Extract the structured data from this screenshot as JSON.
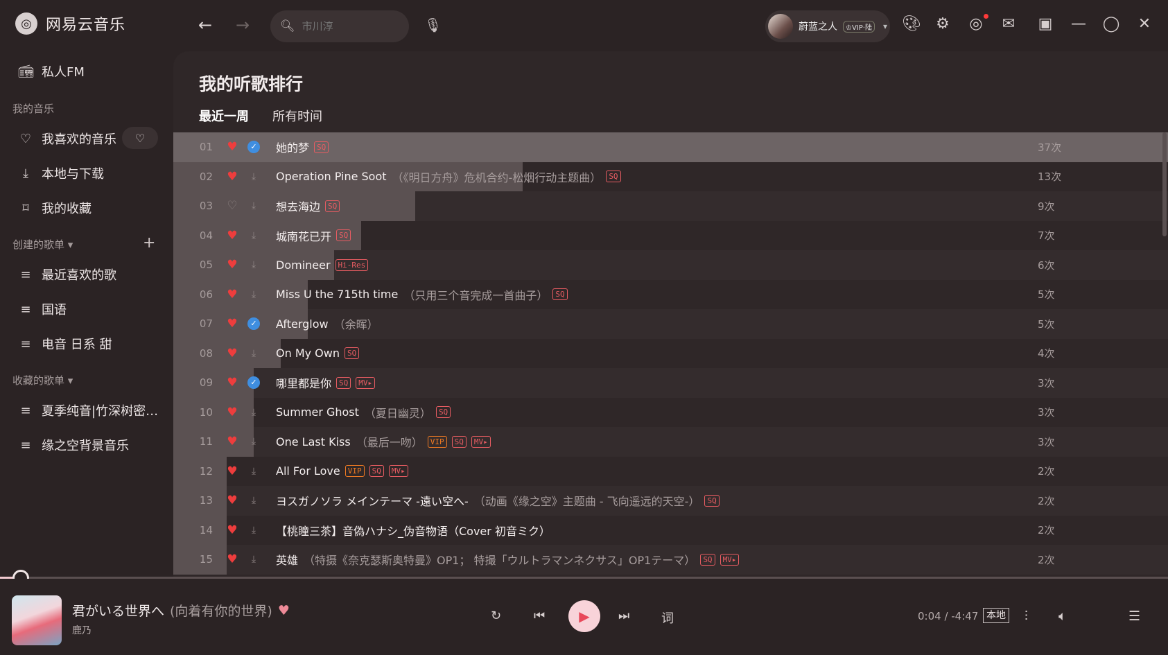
{
  "app": {
    "name": "网易云音乐",
    "logo_glyph": "◎"
  },
  "nav": {
    "back": "←",
    "forward": "→"
  },
  "search": {
    "placeholder": "市川淳",
    "icon": "🔍︎",
    "mic_icon": "🎙︎"
  },
  "user": {
    "name": "蔚蓝之人",
    "vip": "♔VIP·陆",
    "caret": "▾"
  },
  "top_icons": {
    "skin": "🎨︎",
    "settings": "⚙",
    "cloud": "◎",
    "mail": "✉",
    "miniplayer": "▣",
    "minimize": "—",
    "maximize": "◯",
    "close": "✕"
  },
  "sidebar": {
    "fm": {
      "label": "私人FM",
      "icon": "📻︎"
    },
    "section_my_music": "我的音乐",
    "liked": {
      "label": "我喜欢的音乐",
      "icon": "♡",
      "pill_icon": "♡"
    },
    "local": {
      "label": "本地与下载",
      "icon": "⤓"
    },
    "collect": {
      "label": "我的收藏",
      "icon": "⌑"
    },
    "section_created": "创建的歌单 ▾",
    "add_icon": "+",
    "created": [
      {
        "label": "最近喜欢的歌",
        "icon": "≡"
      },
      {
        "label": "国语",
        "icon": "≡"
      },
      {
        "label": "电音 日系 甜",
        "icon": "≡"
      }
    ],
    "section_collected": "收藏的歌单 ▾",
    "collected": [
      {
        "label": "夏季纯音|竹深树密…",
        "icon": "≡"
      },
      {
        "label": "缘之空背景音乐",
        "icon": "≡"
      }
    ]
  },
  "page": {
    "title": "我的听歌排行",
    "tabs": [
      "最近一周",
      "所有时间"
    ]
  },
  "songs": [
    {
      "no": "01",
      "liked": true,
      "downloaded": true,
      "title": "她的梦",
      "sub": "",
      "tags": [
        "SQ"
      ],
      "count": "37次",
      "ratio": 1.0
    },
    {
      "no": "02",
      "liked": true,
      "downloaded": false,
      "title": "Operation Pine Soot",
      "sub": "（《明日方舟》危机合约-松烟行动主题曲）",
      "tags": [
        "SQ"
      ],
      "count": "13次",
      "ratio": 0.351
    },
    {
      "no": "03",
      "liked": false,
      "downloaded": false,
      "title": "想去海边",
      "sub": "",
      "tags": [
        "SQ"
      ],
      "count": "9次",
      "ratio": 0.243
    },
    {
      "no": "04",
      "liked": true,
      "downloaded": false,
      "title": "城南花已开",
      "sub": "",
      "tags": [
        "SQ"
      ],
      "count": "7次",
      "ratio": 0.189
    },
    {
      "no": "05",
      "liked": true,
      "downloaded": false,
      "title": "Domineer",
      "sub": "",
      "tags": [
        "Hi-Res"
      ],
      "count": "6次",
      "ratio": 0.162
    },
    {
      "no": "06",
      "liked": true,
      "downloaded": false,
      "title": "Miss U the 715th time",
      "sub": "（只用三个音完成一首曲子）",
      "tags": [
        "SQ"
      ],
      "count": "5次",
      "ratio": 0.135
    },
    {
      "no": "07",
      "liked": true,
      "downloaded": true,
      "title": "Afterglow",
      "sub": "（余晖）",
      "tags": [],
      "count": "5次",
      "ratio": 0.135
    },
    {
      "no": "08",
      "liked": true,
      "downloaded": false,
      "title": "On My Own",
      "sub": "",
      "tags": [
        "SQ"
      ],
      "count": "4次",
      "ratio": 0.108
    },
    {
      "no": "09",
      "liked": true,
      "downloaded": true,
      "title": "哪里都是你",
      "sub": "",
      "tags": [
        "SQ",
        "MV▸"
      ],
      "count": "3次",
      "ratio": 0.081
    },
    {
      "no": "10",
      "liked": true,
      "downloaded": false,
      "title": "Summer Ghost",
      "sub": "（夏日幽灵）",
      "tags": [
        "SQ"
      ],
      "count": "3次",
      "ratio": 0.081
    },
    {
      "no": "11",
      "liked": true,
      "downloaded": false,
      "title": "One Last Kiss",
      "sub": "（最后一吻）",
      "tags": [
        "VIP",
        "SQ",
        "MV▸"
      ],
      "count": "3次",
      "ratio": 0.081
    },
    {
      "no": "12",
      "liked": true,
      "downloaded": false,
      "title": "All For Love",
      "sub": "",
      "tags": [
        "VIP",
        "SQ",
        "MV▸"
      ],
      "count": "2次",
      "ratio": 0.054
    },
    {
      "no": "13",
      "liked": true,
      "downloaded": false,
      "title": "ヨスガノソラ メインテーマ -遠い空へ-",
      "sub": "（动画《缘之空》主题曲 - 飞向遥远的天空-）",
      "tags": [
        "SQ"
      ],
      "count": "2次",
      "ratio": 0.054
    },
    {
      "no": "14",
      "liked": true,
      "downloaded": false,
      "title": "【桃瞳三茶】音偽ハナシ_伪音物语（Cover 初音ミク）",
      "sub": "",
      "tags": [],
      "count": "2次",
      "ratio": 0.054
    },
    {
      "no": "15",
      "liked": true,
      "downloaded": false,
      "title": "英雄",
      "sub": "（特摄《奈克瑟斯奥特曼》OP1； 特撮「ウルトラマンネクサス」OP1テーマ）",
      "tags": [
        "SQ",
        "MV▸"
      ],
      "count": "2次",
      "ratio": 0.054
    }
  ],
  "player": {
    "progress": 0.014,
    "title": "君がいる世界へ",
    "subtitle": "(向着有你的世界)",
    "heart": "♥",
    "artist": "鹿乃",
    "icons": {
      "mode": "↻",
      "prev": "⏮",
      "play": "▶",
      "next": "⏭",
      "lyrics": "词",
      "quality": "⫶",
      "volume": "🔈︎",
      "playlist": "☰"
    },
    "time": "0:04 / -4:47",
    "local_label": "本地"
  },
  "colors": {
    "accent": "#e8485a",
    "liked": "#ee3d3d",
    "downloaded": "#3f8ee0",
    "tag": "#e85c62",
    "vip": "#ef7a23"
  }
}
